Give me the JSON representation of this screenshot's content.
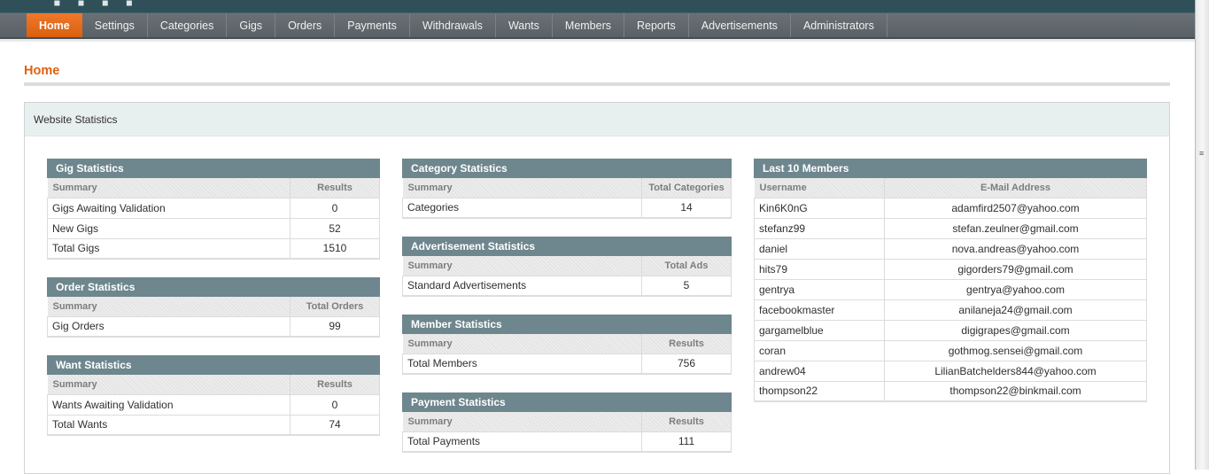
{
  "nav": [
    "Home",
    "Settings",
    "Categories",
    "Gigs",
    "Orders",
    "Payments",
    "Withdrawals",
    "Wants",
    "Members",
    "Reports",
    "Advertisements",
    "Administrators"
  ],
  "page_title": "Home",
  "panel_title": "Website Statistics",
  "gig": {
    "title": "Gig Statistics",
    "cols": [
      "Summary",
      "Results"
    ],
    "rows": [
      [
        "Gigs Awaiting Validation",
        "0"
      ],
      [
        "New Gigs",
        "52"
      ],
      [
        "Total Gigs",
        "1510"
      ]
    ]
  },
  "order": {
    "title": "Order Statistics",
    "cols": [
      "Summary",
      "Total Orders"
    ],
    "rows": [
      [
        "Gig Orders",
        "99"
      ]
    ]
  },
  "want": {
    "title": "Want Statistics",
    "cols": [
      "Summary",
      "Results"
    ],
    "rows": [
      [
        "Wants Awaiting Validation",
        "0"
      ],
      [
        "Total Wants",
        "74"
      ]
    ]
  },
  "category": {
    "title": "Category Statistics",
    "cols": [
      "Summary",
      "Total Categories"
    ],
    "rows": [
      [
        "Categories",
        "14"
      ]
    ]
  },
  "ads": {
    "title": "Advertisement Statistics",
    "cols": [
      "Summary",
      "Total Ads"
    ],
    "rows": [
      [
        "Standard Advertisements",
        "5"
      ]
    ]
  },
  "member": {
    "title": "Member Statistics",
    "cols": [
      "Summary",
      "Results"
    ],
    "rows": [
      [
        "Total Members",
        "756"
      ]
    ]
  },
  "payment": {
    "title": "Payment Statistics",
    "cols": [
      "Summary",
      "Results"
    ],
    "rows": [
      [
        "Total Payments",
        "111"
      ]
    ]
  },
  "members": {
    "title": "Last 10 Members",
    "cols": [
      "Username",
      "E-Mail Address"
    ],
    "rows": [
      [
        "Kin6K0nG",
        "adamfird2507@yahoo.com"
      ],
      [
        "stefanz99",
        "stefan.zeulner@gmail.com"
      ],
      [
        "daniel",
        "nova.andreas@yahoo.com"
      ],
      [
        "hits79",
        "gigorders79@gmail.com"
      ],
      [
        "gentrya",
        "gentrya@yahoo.com"
      ],
      [
        "facebookmaster",
        "anilaneja24@gmail.com"
      ],
      [
        "gargamelblue",
        "digigrapes@gmail.com"
      ],
      [
        "coran",
        "gothmog.sensei@gmail.com"
      ],
      [
        "andrew04",
        "LilianBatchelders844@yahoo.com"
      ],
      [
        "thompson22",
        "thompson22@binkmail.com"
      ]
    ]
  }
}
